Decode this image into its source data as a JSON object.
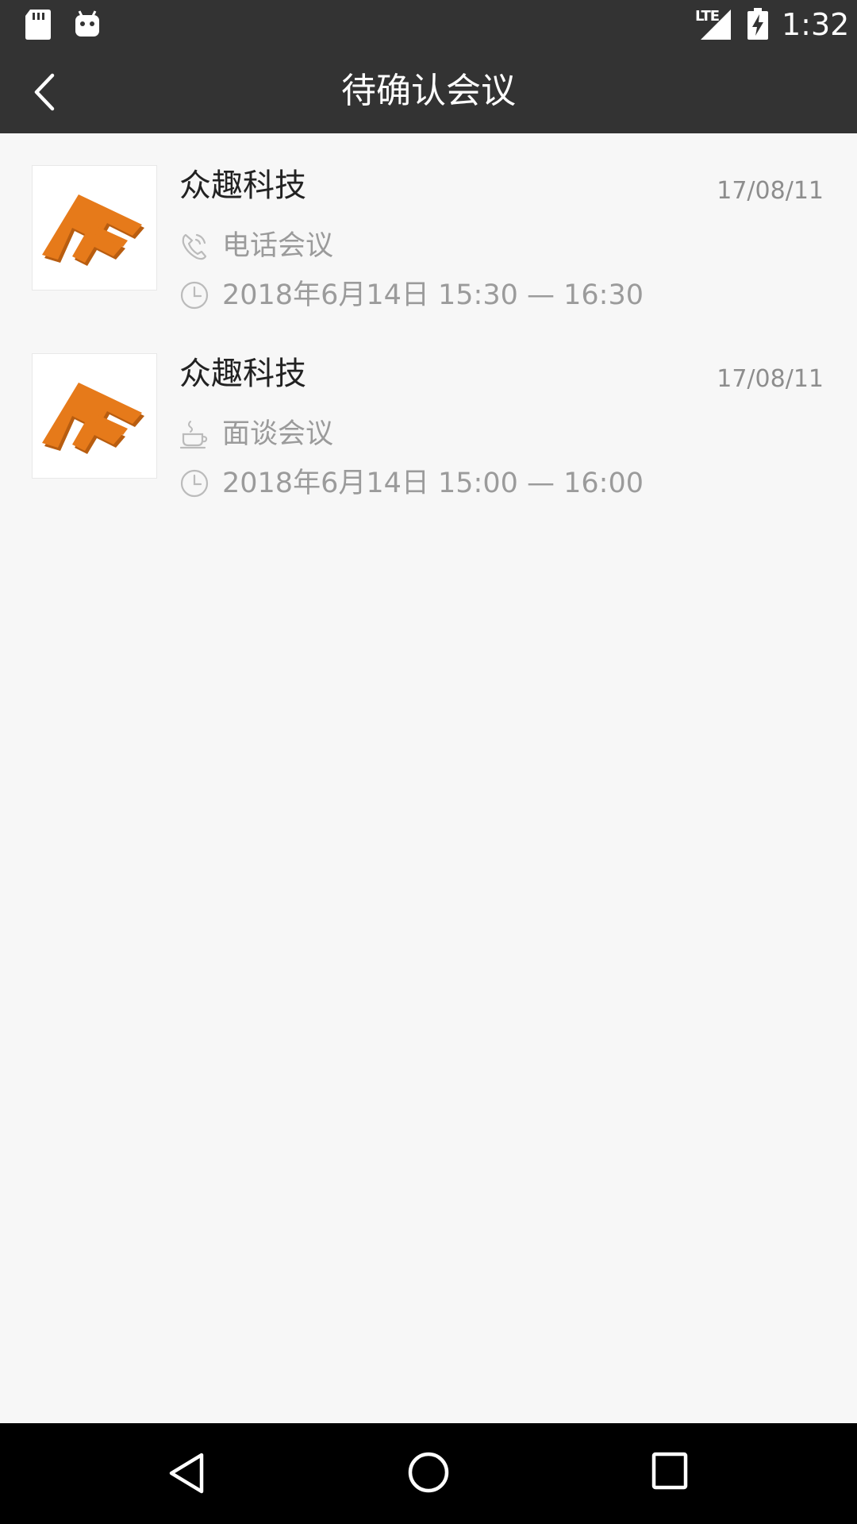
{
  "status_bar": {
    "network": "LTE",
    "time": "1:32",
    "icons": [
      "sd-card-icon",
      "android-icon",
      "signal-icon",
      "battery-charging-icon"
    ]
  },
  "app_bar": {
    "title": "待确认会议",
    "back_icon": "chevron-left-icon"
  },
  "meetings": [
    {
      "company": "众趣科技",
      "date": "17/08/11",
      "type": "电话会议",
      "type_icon": "phone-icon",
      "datetime": "2018年6月14日   15:30 — 16:30",
      "time_icon": "clock-icon"
    },
    {
      "company": "众趣科技",
      "date": "17/08/11",
      "type": "面谈会议",
      "type_icon": "coffee-cup-icon",
      "datetime": "2018年6月14日   15:00 — 16:00",
      "time_icon": "clock-icon"
    }
  ],
  "nav_bar": {
    "icons": [
      "nav-back-icon",
      "nav-home-icon",
      "nav-recent-icon"
    ]
  },
  "colors": {
    "bar": "#333333",
    "background": "#f7f7f7",
    "logo_orange": "#e67a1a",
    "muted_text": "#9b9b9b"
  }
}
